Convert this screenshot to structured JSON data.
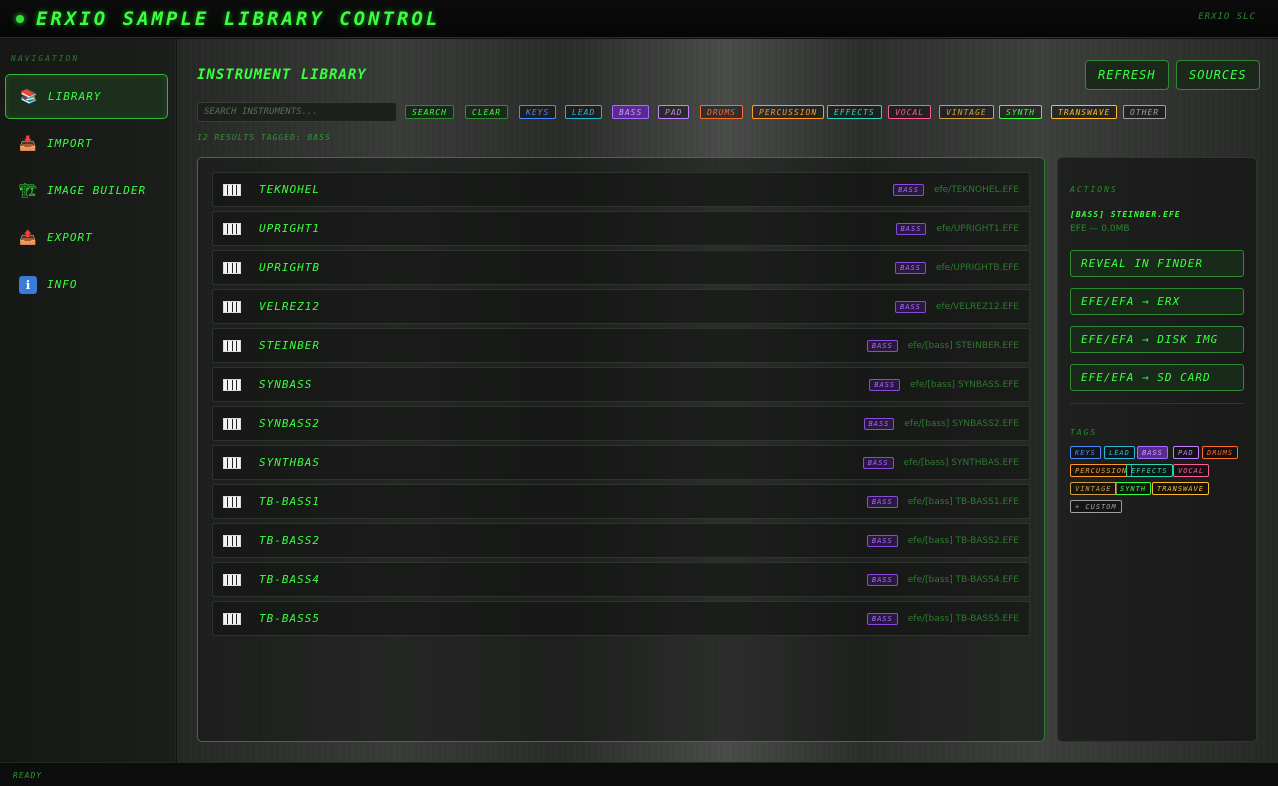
{
  "app": {
    "title": "ERXIO SAMPLE LIBRARY CONTROL",
    "brand": "ERXIO SLC"
  },
  "sidebar": {
    "heading": "NAVIGATION",
    "items": [
      {
        "label": "LIBRARY",
        "icon": "books-icon",
        "glyph": "📚"
      },
      {
        "label": "IMPORT",
        "icon": "inbox-tray-icon",
        "glyph": "📥"
      },
      {
        "label": "IMAGE BUILDER",
        "icon": "crane-icon",
        "glyph": "🏗"
      },
      {
        "label": "EXPORT",
        "icon": "outbox-tray-icon",
        "glyph": "📤"
      },
      {
        "label": "INFO",
        "icon": "info-icon",
        "glyph": "ℹ"
      }
    ]
  },
  "main": {
    "title": "INSTRUMENT LIBRARY",
    "refresh_label": "REFRESH",
    "sources_label": "SOURCES",
    "search_placeholder": "SEARCH INSTRUMENTS...",
    "search_label": "SEARCH",
    "clear_label": "CLEAR",
    "filters": [
      {
        "label": "KEYS",
        "color": "#4a8aff"
      },
      {
        "label": "LEAD",
        "color": "#2ab8d8"
      },
      {
        "label": "BASS",
        "color": "#a66bff",
        "active": true
      },
      {
        "label": "PAD",
        "color": "#c080ff"
      },
      {
        "label": "DRUMS",
        "color": "#ff6a2a"
      },
      {
        "label": "PERCUSSION",
        "color": "#ff9a2a"
      },
      {
        "label": "EFFECTS",
        "color": "#2ad8b8"
      },
      {
        "label": "VOCAL",
        "color": "#ff5a9a"
      },
      {
        "label": "VINTAGE",
        "color": "#d0a040"
      },
      {
        "label": "SYNTH",
        "color": "#39ff3e"
      },
      {
        "label": "TRANSWAVE",
        "color": "#ffb82a"
      },
      {
        "label": "OTHER",
        "color": "#a0a0a0"
      }
    ],
    "results_text": "12 RESULTS TAGGED: BASS",
    "rows": [
      {
        "name": "TEKNOHEL",
        "tag": "BASS",
        "path": "efe/TEKNOHEL.EFE"
      },
      {
        "name": "UPRIGHT1",
        "tag": "BASS",
        "path": "efe/UPRIGHT1.EFE"
      },
      {
        "name": "UPRIGHTB",
        "tag": "BASS",
        "path": "efe/UPRIGHTB.EFE"
      },
      {
        "name": "VELREZ12",
        "tag": "BASS",
        "path": "efe/VELREZ12.EFE"
      },
      {
        "name": "STEINBER",
        "tag": "BASS",
        "path": "efe/[bass] STEINBER.EFE"
      },
      {
        "name": "SYNBASS",
        "tag": "BASS",
        "path": "efe/[bass] SYNBASS.EFE"
      },
      {
        "name": "SYNBASS2",
        "tag": "BASS",
        "path": "efe/[bass] SYNBASS2.EFE"
      },
      {
        "name": "SYNTHBAS",
        "tag": "BASS",
        "path": "efe/[bass] SYNTHBAS.EFE"
      },
      {
        "name": "TB-BASS1",
        "tag": "BASS",
        "path": "efe/[bass] TB-BASS1.EFE"
      },
      {
        "name": "TB-BASS2",
        "tag": "BASS",
        "path": "efe/[bass] TB-BASS2.EFE"
      },
      {
        "name": "TB-BASS4",
        "tag": "BASS",
        "path": "efe/[bass] TB-BASS4.EFE"
      },
      {
        "name": "TB-BASS5",
        "tag": "BASS",
        "path": "efe/[bass] TB-BASS5.EFE"
      }
    ]
  },
  "actions": {
    "heading": "ACTIONS",
    "selected_name": "[BASS] STEINBER.EFE",
    "selected_meta": "EFE — 0.0MB",
    "buttons": [
      "REVEAL IN FINDER",
      "EFE/EFA → ERX",
      "EFE/EFA → DISK IMG",
      "EFE/EFA → SD CARD"
    ],
    "tags_heading": "TAGS",
    "tags": [
      {
        "label": "KEYS",
        "color": "#4a8aff"
      },
      {
        "label": "LEAD",
        "color": "#2ab8d8"
      },
      {
        "label": "BASS",
        "color": "#a66bff",
        "active": true
      },
      {
        "label": "PAD",
        "color": "#c080ff"
      },
      {
        "label": "DRUMS",
        "color": "#ff6a2a"
      },
      {
        "label": "PERCUSSION",
        "color": "#ff9a2a"
      },
      {
        "label": "EFFECTS",
        "color": "#2ad8b8"
      },
      {
        "label": "VOCAL",
        "color": "#ff5a9a"
      },
      {
        "label": "VINTAGE",
        "color": "#d0a040"
      },
      {
        "label": "SYNTH",
        "color": "#39ff3e"
      },
      {
        "label": "TRANSWAVE",
        "color": "#ffb82a"
      },
      {
        "label": "+ CUSTOM",
        "color": "#a0a0a0"
      }
    ]
  },
  "status": {
    "text": "READY"
  }
}
